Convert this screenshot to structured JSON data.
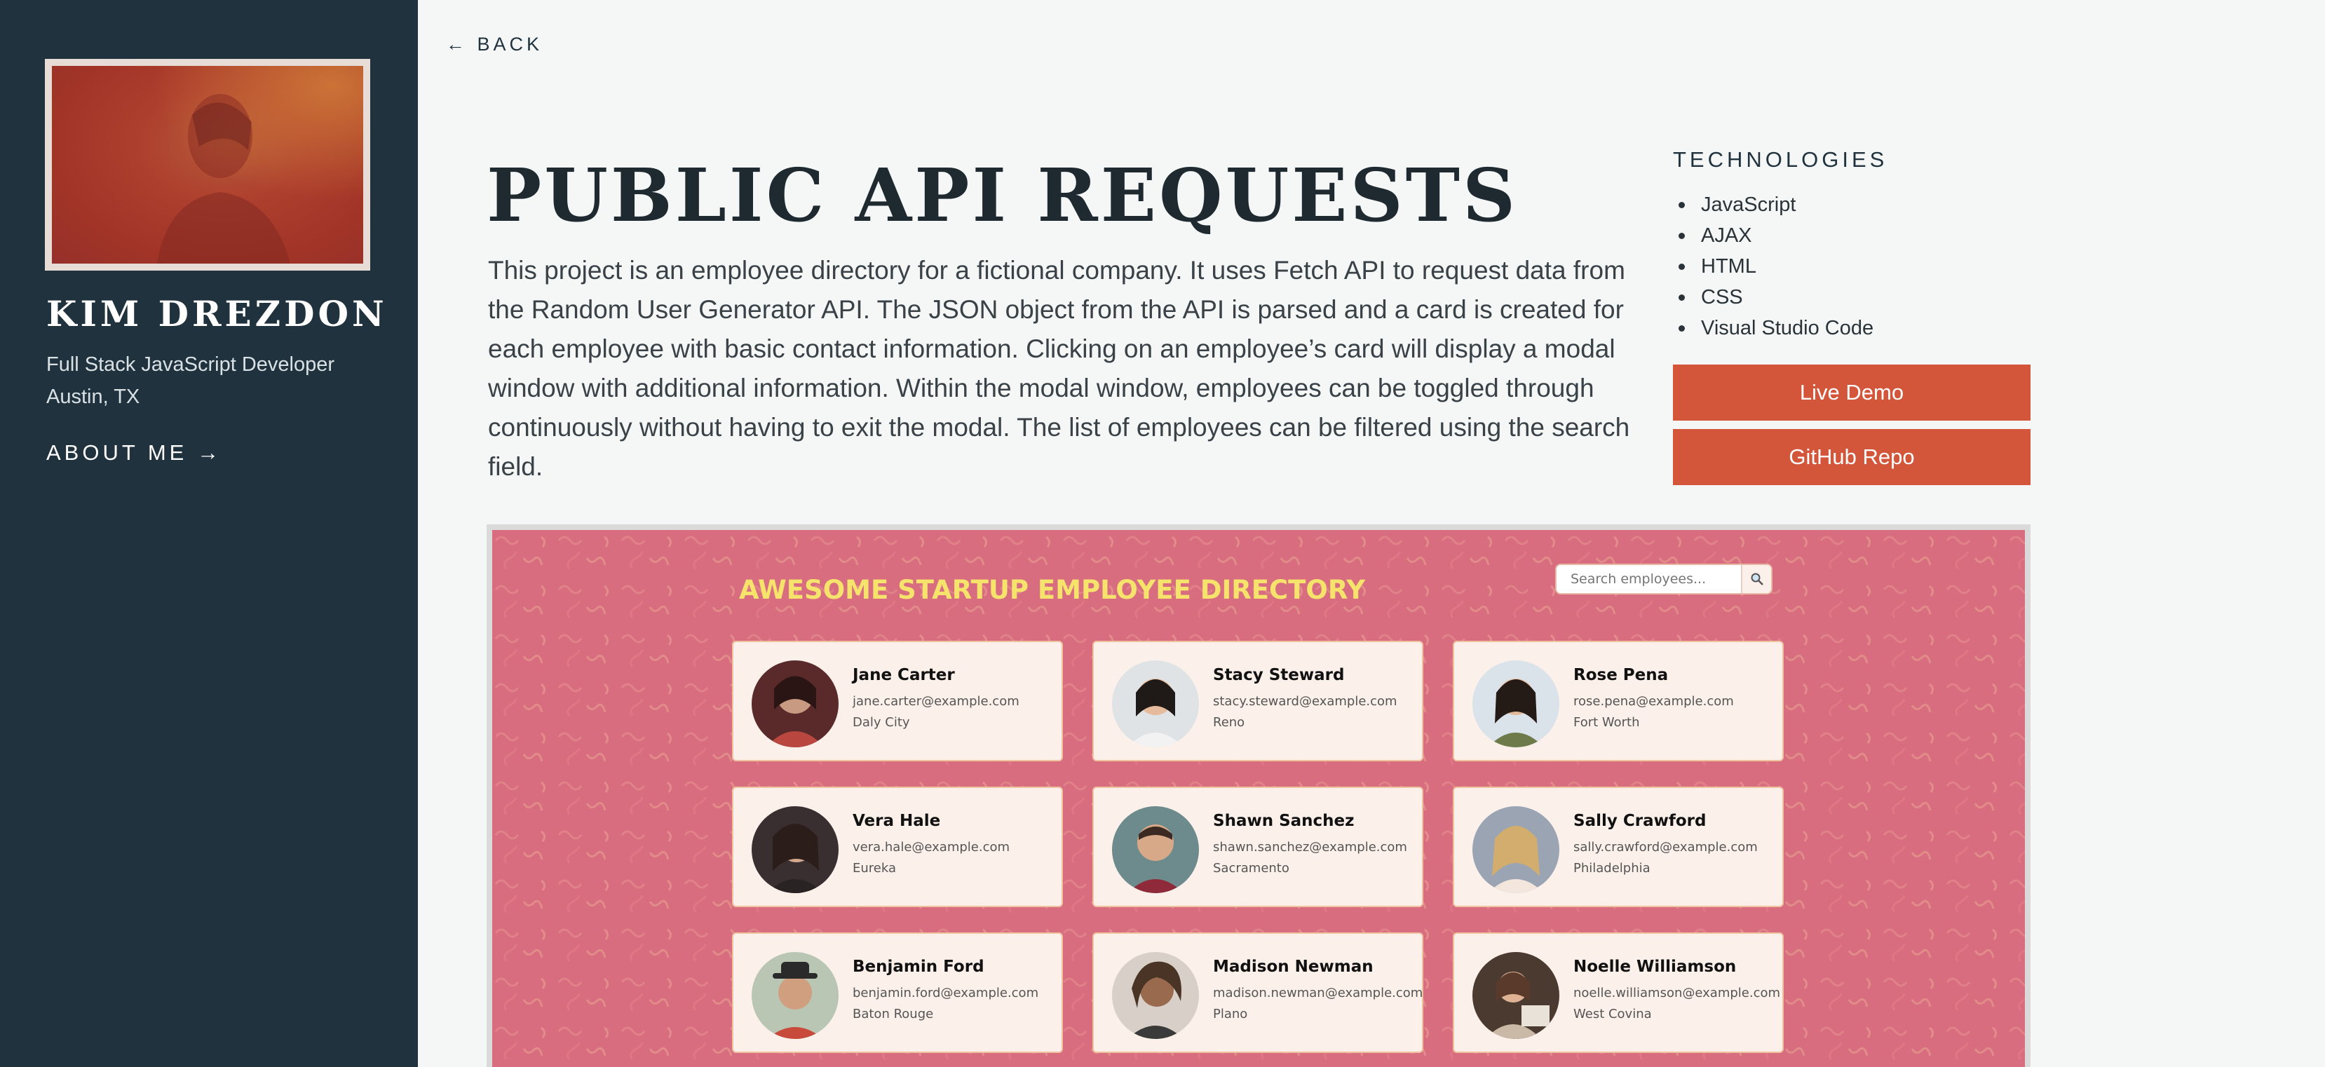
{
  "sidebar": {
    "name": "KIM DREZDON",
    "role": "Full Stack JavaScript Developer",
    "location": "Austin, TX",
    "about_label": "ABOUT ME →"
  },
  "main": {
    "back_label": "← BACK",
    "title": "PUBLIC API REQUESTS",
    "description": "This project is an employee directory for a fictional company. It uses Fetch API to request data from the Random User Generator API. The JSON object from the API is parsed and a card is created for each employee with basic contact information. Clicking on an employee’s card will display a modal window with additional information. Within the modal window, employees can be toggled through continuously without having to exit the modal. The list of employees can be filtered using the search field.",
    "technologies_heading": "TECHNOLOGIES",
    "technologies": [
      "JavaScript",
      "AJAX",
      "HTML",
      "CSS",
      "Visual Studio Code"
    ],
    "live_demo_label": "Live Demo",
    "github_label": "GitHub Repo"
  },
  "screenshot": {
    "directory_title": "AWESOME STARTUP EMPLOYEE DIRECTORY",
    "search_placeholder": "Search employees...",
    "employees": [
      {
        "name": "Jane Carter",
        "email": "jane.carter@example.com",
        "city": "Daly City"
      },
      {
        "name": "Stacy Steward",
        "email": "stacy.steward@example.com",
        "city": "Reno"
      },
      {
        "name": "Rose Pena",
        "email": "rose.pena@example.com",
        "city": "Fort Worth"
      },
      {
        "name": "Vera Hale",
        "email": "vera.hale@example.com",
        "city": "Eureka"
      },
      {
        "name": "Shawn Sanchez",
        "email": "shawn.sanchez@example.com",
        "city": "Sacramento"
      },
      {
        "name": "Sally Crawford",
        "email": "sally.crawford@example.com",
        "city": "Philadelphia"
      },
      {
        "name": "Benjamin Ford",
        "email": "benjamin.ford@example.com",
        "city": "Baton Rouge"
      },
      {
        "name": "Madison Newman",
        "email": "madison.newman@example.com",
        "city": "Plano"
      },
      {
        "name": "Noelle Williamson",
        "email": "noelle.williamson@example.com",
        "city": "West Covina"
      }
    ]
  },
  "colors": {
    "sidebar_bg": "#1f323d",
    "page_bg": "#f4f7f6",
    "accent_button": "#d3553a",
    "directory_bg": "#d86d80",
    "directory_title": "#f5e36b",
    "card_bg": "#fbf0ea"
  },
  "icons": {
    "search": "magnifier-icon"
  }
}
